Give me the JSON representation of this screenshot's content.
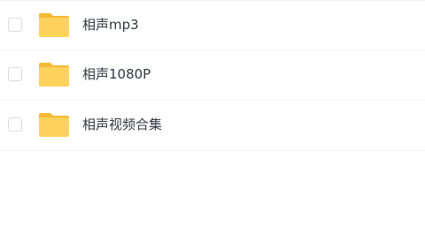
{
  "folder_color": "#ffd25c",
  "folder_tab_color": "#f5b935",
  "files": [
    {
      "name": "相声mp3",
      "icon": "folder-icon"
    },
    {
      "name": "相声1080P",
      "icon": "folder-icon"
    },
    {
      "name": "相声视频合集",
      "icon": "folder-icon"
    }
  ]
}
